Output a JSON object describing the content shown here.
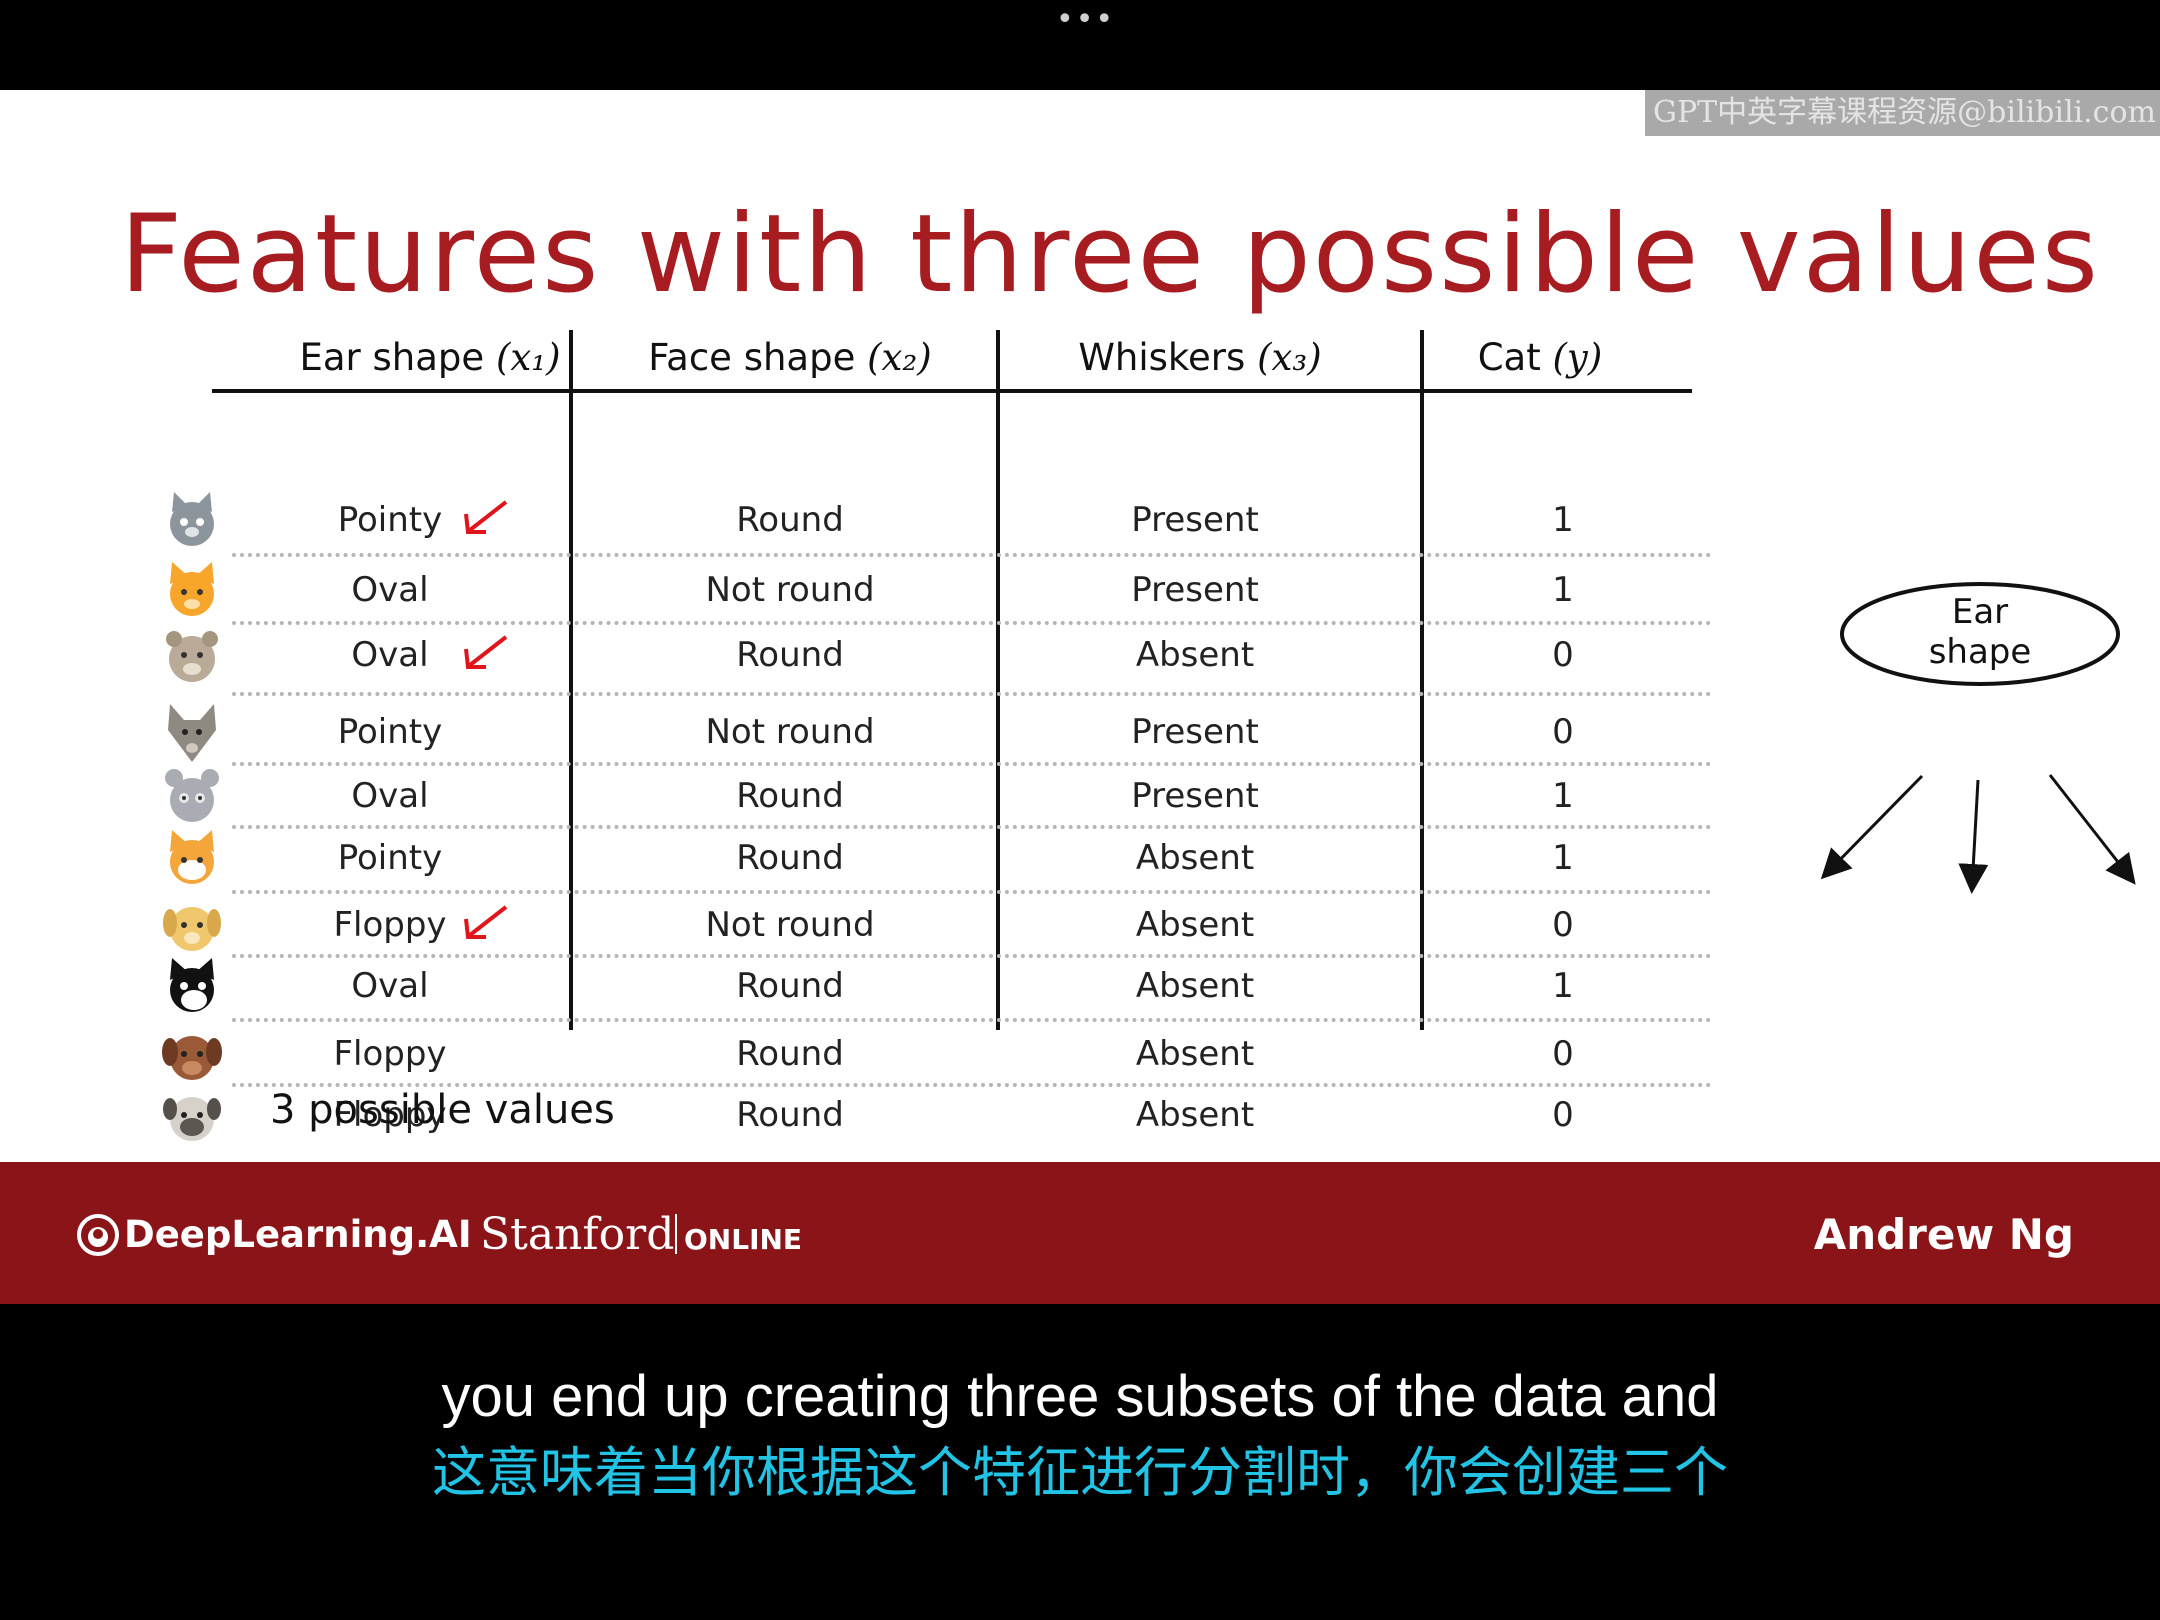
{
  "player": {
    "more_dots": "•••"
  },
  "watermark": "GPT中英字幕课程资源@bilibili.com",
  "slide": {
    "title": "Features with three possible values",
    "columns": [
      {
        "label": "Ear shape",
        "var": "(x₁)"
      },
      {
        "label": "Face shape",
        "var": "(x₂)"
      },
      {
        "label": "Whiskers",
        "var": "(x₃)"
      },
      {
        "label": "Cat",
        "var": "(y)"
      }
    ],
    "rows": [
      {
        "ear": "Pointy",
        "face": "Round",
        "whiskers": "Present",
        "cat": "1",
        "animal": "gray-cat-icon",
        "arrow": true
      },
      {
        "ear": "Oval",
        "face": "Not round",
        "whiskers": "Present",
        "cat": "1",
        "animal": "orange-cat-icon",
        "arrow": false
      },
      {
        "ear": "Oval",
        "face": "Round",
        "whiskers": "Absent",
        "cat": "0",
        "animal": "tan-dog-icon",
        "arrow": true
      },
      {
        "ear": "Pointy",
        "face": "Not round",
        "whiskers": "Present",
        "cat": "0",
        "animal": "wolf-icon",
        "arrow": false
      },
      {
        "ear": "Oval",
        "face": "Round",
        "whiskers": "Present",
        "cat": "1",
        "animal": "gray-kitten-icon",
        "arrow": false
      },
      {
        "ear": "Pointy",
        "face": "Round",
        "whiskers": "Absent",
        "cat": "1",
        "animal": "orange-white-cat-icon",
        "arrow": false
      },
      {
        "ear": "Floppy",
        "face": "Not round",
        "whiskers": "Absent",
        "cat": "0",
        "animal": "yellow-dog-icon",
        "arrow": true
      },
      {
        "ear": "Oval",
        "face": "Round",
        "whiskers": "Absent",
        "cat": "1",
        "animal": "tuxedo-cat-icon",
        "arrow": false
      },
      {
        "ear": "Floppy",
        "face": "Round",
        "whiskers": "Absent",
        "cat": "0",
        "animal": "brown-dog-icon",
        "arrow": false
      },
      {
        "ear": "Floppy",
        "face": "Round",
        "whiskers": "Absent",
        "cat": "0",
        "animal": "pug-dog-icon",
        "arrow": false
      }
    ],
    "note": "3 possible values",
    "tree": {
      "root_label_line1": "Ear",
      "root_label_line2": "shape"
    }
  },
  "footer": {
    "brand": "DeepLearning.AI",
    "university": "Stanford",
    "online": "ONLINE",
    "author": "Andrew Ng"
  },
  "subtitles": {
    "en": "you end up creating three subsets of the data and",
    "zh": "这意味着当你根据这个特征进行分割时，你会创建三个"
  },
  "colors": {
    "title": "#a61c20",
    "footer_bg": "#8b1419",
    "arrow": "#e0141b",
    "subtitle_zh": "#22c4e6"
  }
}
